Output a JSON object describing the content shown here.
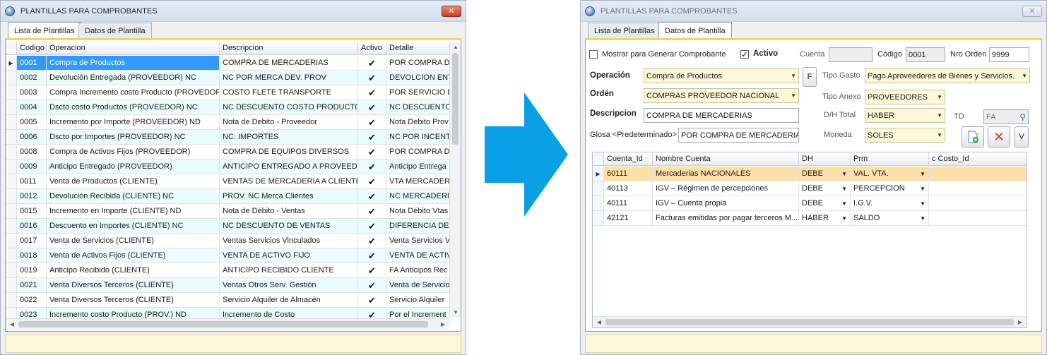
{
  "left_window": {
    "title": "PLANTILLAS PARA COMPROBANTES",
    "close_label": "✕",
    "tabs": [
      {
        "label": "Lista de Plantillas"
      },
      {
        "label": "Datos de Plantilla"
      }
    ],
    "columns": [
      "Codigo",
      "Operacion",
      "Descripcion",
      "Activo",
      "Detalle"
    ],
    "rows": [
      {
        "codigo": "0001",
        "operacion": "Compra de Productos",
        "descripcion": "COMPRA DE MERCADERIAS",
        "detalle": "POR COMPRA DE"
      },
      {
        "codigo": "0002",
        "operacion": "Devolución Entregada (PROVEEDOR) NC",
        "descripcion": "NC POR MERCA DEV. PROV",
        "detalle": "DEVOLCION ENT"
      },
      {
        "codigo": "0003",
        "operacion": "Compra Incremento costo Producto (PROVEDOR)",
        "descripcion": "COSTO FLETE TRANSPORTE",
        "detalle": "POR SERVICIO D"
      },
      {
        "codigo": "0004",
        "operacion": "Dscto costo Productos (PROVEEDOR) NC",
        "descripcion": "NC DESCUENTO COSTO PRODUCTO",
        "detalle": "NC DESCUENTO"
      },
      {
        "codigo": "0005",
        "operacion": "Incremento por Importe (PROVEEDOR) ND",
        "descripcion": "Nota de Debito - Proveedor",
        "detalle": "Nota Debito Prov"
      },
      {
        "codigo": "0006",
        "operacion": "Dscto por Importes (PROVEEDOR) NC",
        "descripcion": "NC. IMPORTES",
        "detalle": "NC POR INCENT"
      },
      {
        "codigo": "0008",
        "operacion": "Compra de Activos Fijos  (PROVEEDOR)",
        "descripcion": "COMPRA DE EQUIPOS DIVERSOS",
        "detalle": "POR COMPRA DE"
      },
      {
        "codigo": "0009",
        "operacion": "Anticipo Entregado  (PROVEEDOR)",
        "descripcion": "ANTICIPO ENTREGADO A PROVEEDOR",
        "detalle": "Anticipo Entrega"
      },
      {
        "codigo": "0011",
        "operacion": "Venta de Productos (CLIENTE)",
        "descripcion": "VENTAS DE MERCADERIA A CLIENTE",
        "detalle": "VTA MERCADERI"
      },
      {
        "codigo": "0012",
        "operacion": "Devolución Recibida (CLIENTE) NC",
        "descripcion": "PROV. NC Merca Clientes",
        "detalle": "NC MERCADERIA"
      },
      {
        "codigo": "0015",
        "operacion": "Incremento en Importe (CLIENTE) ND",
        "descripcion": "Nota de Débito - Ventas",
        "detalle": "Nota Débito Vtas"
      },
      {
        "codigo": "0016",
        "operacion": "Descuento en Importes (CLIENTE) NC",
        "descripcion": "NC DESCUENTO DE VENTAS",
        "detalle": "DIFERENCIA DE"
      },
      {
        "codigo": "0017",
        "operacion": "Venta de Servicios  (CLIENTE)",
        "descripcion": "Ventas Servicios Vinculados",
        "detalle": "Venta Servicios V"
      },
      {
        "codigo": "0018",
        "operacion": "Venta de Activos Fijos (CLIENTE)",
        "descripcion": "VENTA DE ACTIVO FIJO",
        "detalle": "VENTA DE ACTIV"
      },
      {
        "codigo": "0019",
        "operacion": "Anticipo Recibido (CLIENTE)",
        "descripcion": "ANTICIPO RECIBIDO CLIENTE",
        "detalle": "FA Anticipos Rec"
      },
      {
        "codigo": "0021",
        "operacion": "Venta Diversos Terceros  (CLIENTE)",
        "descripcion": "Ventas Otros Serv. Gestión",
        "detalle": "Venta de Servicio"
      },
      {
        "codigo": "0022",
        "operacion": "Venta Diversos Terceros  (CLIENTE)",
        "descripcion": "Servicio Alquiler de Almacén",
        "detalle": "Servicio Alquiler"
      },
      {
        "codigo": "0023",
        "operacion": "Incremento costo Producto (PROV.) ND",
        "descripcion": "Incremento de Costo",
        "detalle": "Por el Increment"
      }
    ]
  },
  "right_window": {
    "title": "PLANTILLAS PARA COMPROBANTES",
    "close_label": "✕",
    "tabs": [
      {
        "label": "Lista de Plantillas"
      },
      {
        "label": "Datos de Plantilla"
      }
    ],
    "form": {
      "mostrar_label": "Mostrar para Generar  Comprobante",
      "activo_label": "Activo",
      "cuenta_label": "Cuenta",
      "cuenta_value": "",
      "codigo_label": "Código",
      "codigo_value": "0001",
      "nro_orden_label": "Nro Orden",
      "nro_orden_value": "9999",
      "operacion_label": "Operación",
      "operacion_value": "Compra de Productos",
      "f_label": "F",
      "tipo_gasto_label": "Tipo Gasto",
      "tipo_gasto_value": "Pago  Aproveedores de Bienes y Servicios.",
      "orden_label": "Ordén",
      "orden_value": "COMPRAS PROVEEDOR NACIONAL",
      "tipo_anexo_label": "Tipo Anexo",
      "tipo_anexo_value": "PROVEEDORES",
      "descripcion_label": "Descripcion",
      "descripcion_value": "COMPRA DE MERCADERIAS",
      "dh_total_label": "D/H Total",
      "dh_total_value": "HABER",
      "td_label": "TD",
      "td_value": "FA",
      "glosa_label": "Glosa <Predeterminado>",
      "glosa_value": "POR COMPRA DE MERCADERIAS",
      "moneda_label": "Moneda",
      "moneda_value": "SOLES",
      "v_label": "V"
    },
    "columns": [
      "Cuenta_Id",
      "Nombre Cuenta",
      "DH",
      "Prm",
      "c Costo_Id"
    ],
    "rows": [
      {
        "cuenta": "60111",
        "nombre": "Mercaderias NACIONALES",
        "dh": "DEBE",
        "prm": "VAL. VTA."
      },
      {
        "cuenta": "40113",
        "nombre": "IGV – Régimen de percepciones",
        "dh": "DEBE",
        "prm": "PERCEPCION"
      },
      {
        "cuenta": "40111",
        "nombre": "IGV – Cuenta propia",
        "dh": "DEBE",
        "prm": "I.G.V."
      },
      {
        "cuenta": "42121",
        "nombre": "Facturas emitidas por pagar terceros M...",
        "dh": "HABER",
        "prm": "SALDO"
      }
    ]
  },
  "colors": {
    "arrow": "#0aa0e6",
    "selection": "#3399ff",
    "current_row": "#fde0a8",
    "alt_row": "#eafcfc",
    "tab_accent": "#f0d46a"
  }
}
